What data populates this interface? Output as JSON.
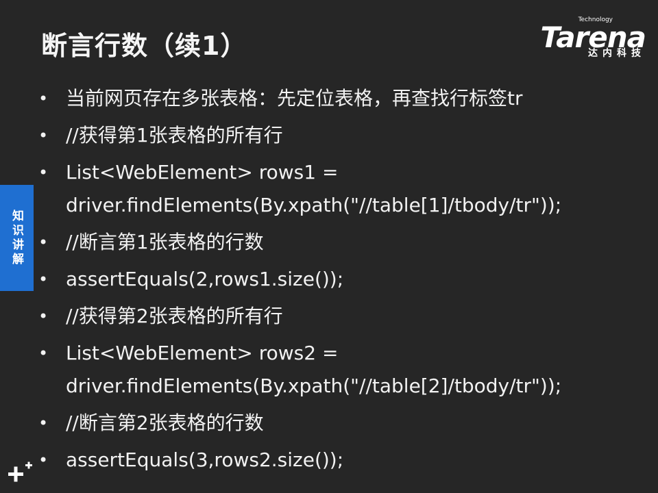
{
  "slide": {
    "title": "断言行数（续1）",
    "logo": {
      "small_text": "Technology",
      "brand": "Tarena",
      "subtitle": "达内科技"
    },
    "side_tab": "知识讲解",
    "bullets": [
      "当前网页存在多张表格：先定位表格，再查找行标签tr",
      "//获得第1张表格的所有行",
      "List<WebElement> rows1 = driver.findElements(By.xpath(\"//table[1]/tbody/tr\"));",
      "//断言第1张表格的行数",
      "assertEquals(2,rows1.size());",
      "//获得第2张表格的所有行",
      "List<WebElement> rows2 = driver.findElements(By.xpath(\"//table[2]/tbody/tr\"));",
      "//断言第2张表格的行数",
      "assertEquals(3,rows2.size());"
    ],
    "bullet_symbol": "•",
    "colors": {
      "background": "#262626",
      "accent": "#1f6fd1",
      "text": "#f2f2f2"
    },
    "icons": {
      "corner": "plus-icon"
    }
  }
}
